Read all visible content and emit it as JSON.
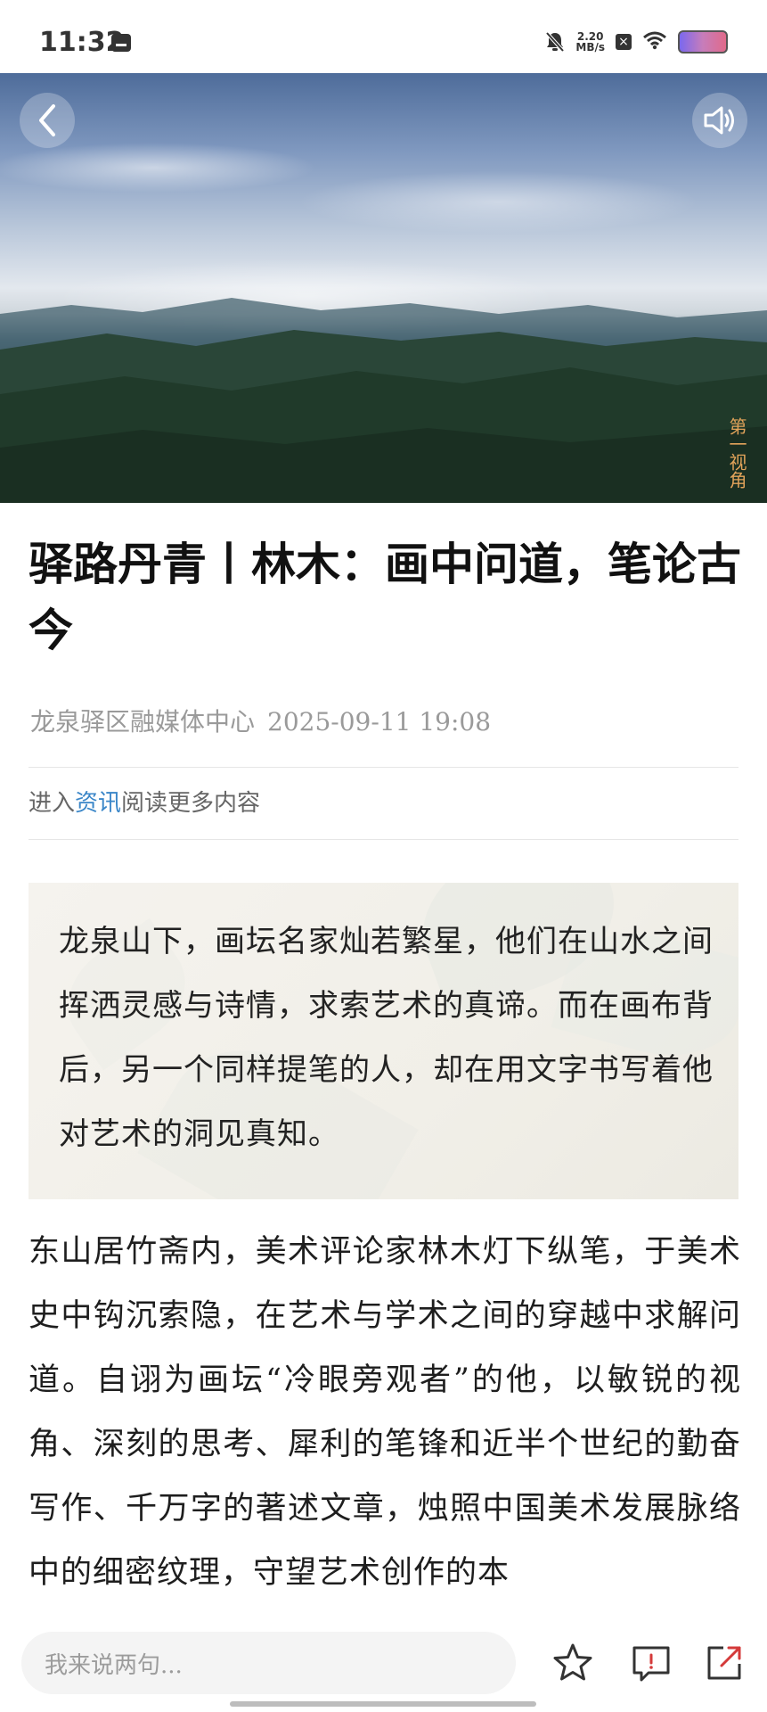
{
  "status_bar": {
    "time": "11:32",
    "net_speed_value": "2.20",
    "net_speed_unit": "MB/s",
    "icons": [
      "message-icon",
      "mute-bell-icon",
      "close-box-icon",
      "wifi-icon",
      "battery-icon"
    ]
  },
  "hero": {
    "badge": "第一视角",
    "back_icon": "chevron-left-icon",
    "sound_icon": "speaker-icon"
  },
  "article": {
    "title": "驿路丹青丨林木：画中问道，笔论古今",
    "source": "龙泉驿区融媒体中心",
    "date": "2025-09-11 19:08",
    "more_prefix": "进入",
    "more_link": "资讯",
    "more_suffix": "阅读更多内容",
    "summary": "龙泉山下，画坛名家灿若繁星，他们在山水之间挥洒灵感与诗情，求索艺术的真谛。而在画布背后，另一个同样提笔的人，却在用文字书写着他对艺术的洞见真知。",
    "body": "东山居竹斋内，美术评论家林木灯下纵笔，于美术史中钩沉索隐，在艺术与学术之间的穿越中求解问道。自诩为画坛“冷眼旁观者”的他，以敏锐的视角、深刻的思考、犀利的笔锋和近半个世纪的勤奋写作、千万字的著述文章，烛照中国美术发展脉络中的细密纹理，守望艺术创作的本"
  },
  "bottom_bar": {
    "comment_placeholder": "我来说两句...",
    "icons": [
      "star-icon",
      "comment-icon",
      "share-icon"
    ]
  },
  "colors": {
    "link": "#3a86c8",
    "meta_text": "#9a9a9a",
    "badge": "#e2a35a"
  }
}
